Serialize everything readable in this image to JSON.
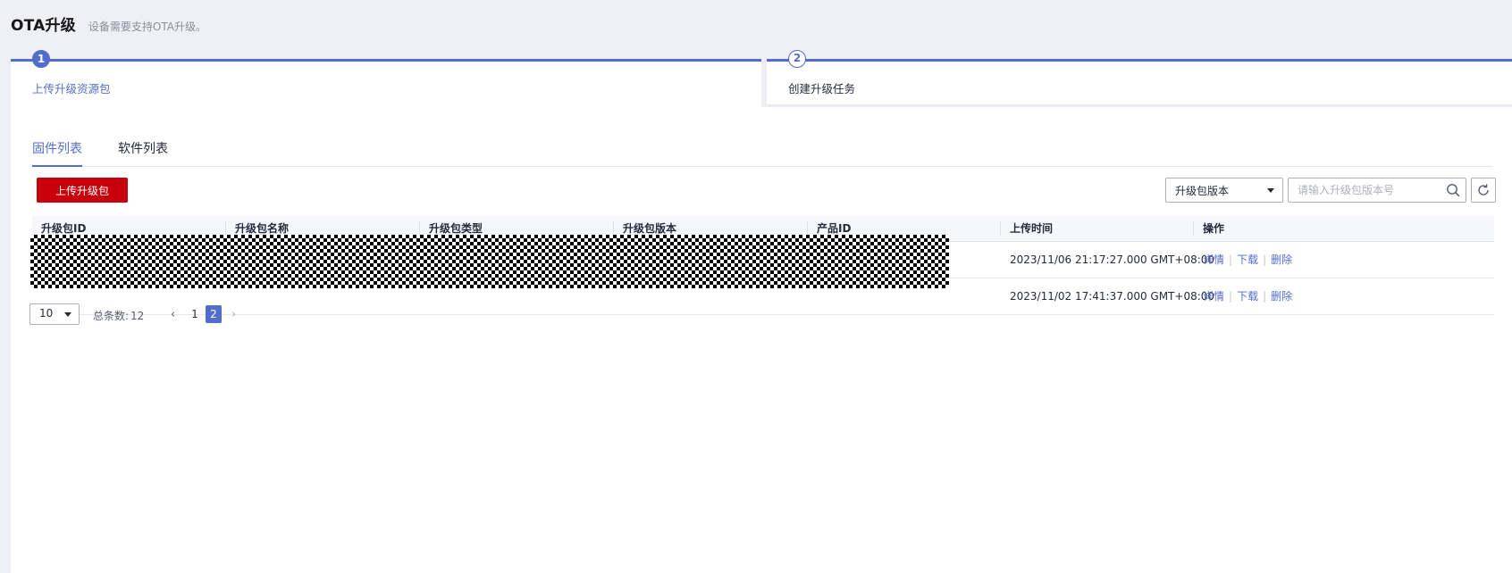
{
  "header": {
    "title": "OTA升级",
    "subtitle": "设备需要支持OTA升级。"
  },
  "steps": [
    {
      "number": "1",
      "label": "上传升级资源包"
    },
    {
      "number": "2",
      "label": "创建升级任务"
    }
  ],
  "tabs": [
    {
      "label": "固件列表",
      "active": true
    },
    {
      "label": "软件列表",
      "active": false
    }
  ],
  "toolbar": {
    "upload_label": "上传升级包",
    "filter_select_value": "升级包版本",
    "search_placeholder": "请输入升级包版本号"
  },
  "table": {
    "columns": [
      "升级包ID",
      "升级包名称",
      "升级包类型",
      "升级包版本",
      "产品ID",
      "上传时间",
      "操作"
    ],
    "rows": [
      {
        "upload_time": "2023/11/06 21:17:27.000 GMT+08:00",
        "ops": [
          "详情",
          "下载",
          "删除"
        ]
      },
      {
        "upload_time": "2023/11/02 17:41:37.000 GMT+08:00",
        "ops": [
          "详情",
          "下载",
          "删除"
        ]
      }
    ]
  },
  "pagination": {
    "page_size": "10",
    "total_label": "总条数:",
    "total": "12",
    "pages": [
      "1",
      "2"
    ],
    "current_page": "2"
  },
  "colors": {
    "accent": "#526ecc",
    "primary_button": "#c7000b",
    "page_background": "#eff0f5"
  },
  "icons": {
    "search": "search-icon",
    "refresh": "refresh-icon",
    "caret": "caret-down-icon",
    "prev": "chevron-left-icon",
    "next": "chevron-right-icon"
  }
}
